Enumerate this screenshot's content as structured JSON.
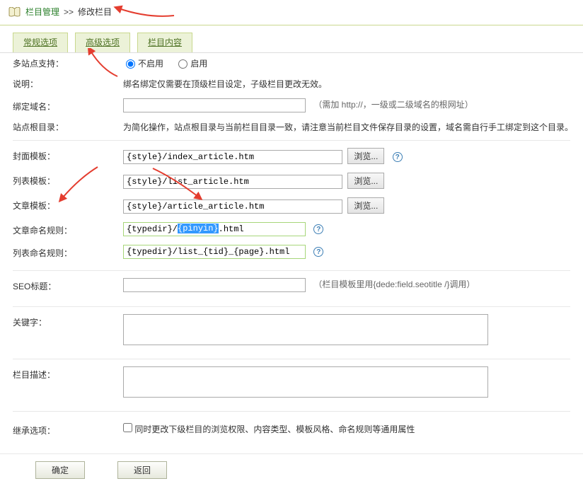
{
  "crumb": {
    "root": "栏目管理",
    "sep": ">>",
    "current": "修改栏目"
  },
  "tabs": [
    {
      "label": "常规选项",
      "name": "tab-general"
    },
    {
      "label": "高级选项",
      "name": "tab-advanced"
    },
    {
      "label": "栏目内容",
      "name": "tab-content"
    }
  ],
  "labels": {
    "multisite": "多站点支持：",
    "explain": "说明：",
    "bind_domain": "绑定域名：",
    "site_root": "站点根目录：",
    "tpl_cover": "封面模板：",
    "tpl_list": "列表模板：",
    "tpl_article": "文章模板：",
    "rule_article": "文章命名规则：",
    "rule_list": "列表命名规则：",
    "seo_title": "SEO标题：",
    "keywords": "关键字：",
    "description": "栏目描述：",
    "inherit": "继承选项："
  },
  "multisite": {
    "opt_disable": "不启用",
    "opt_enable": "启用"
  },
  "explain_text": "绑名绑定仅需要在顶级栏目设定，子级栏目更改无效。",
  "bind_domain": {
    "value": "",
    "hint": "（需加 http://，一级或二级域名的根网址）"
  },
  "site_root_text": "为简化操作，站点根目录与当前栏目目录一致，请注意当前栏目文件保存目录的设置，域名需自行手工绑定到这个目录。",
  "templates": {
    "cover": {
      "value": "{style}/index_article.htm"
    },
    "list": {
      "value": "{style}/list_article.htm"
    },
    "article": {
      "value": "{style}/article_article.htm"
    }
  },
  "browse_label": "浏览...",
  "rules": {
    "article": {
      "pre": "{typedir}/",
      "sel": "{pinyin}",
      "post": ".html"
    },
    "list": {
      "value": "{typedir}/list_{tid}_{page}.html"
    }
  },
  "seo_hint": "（栏目模板里用{dede:field.seotitle /}调用）",
  "inherit_text": "同时更改下级栏目的浏览权限、内容类型、模板风格、命名规则等通用属性",
  "buttons": {
    "ok": "确定",
    "back": "返回"
  }
}
